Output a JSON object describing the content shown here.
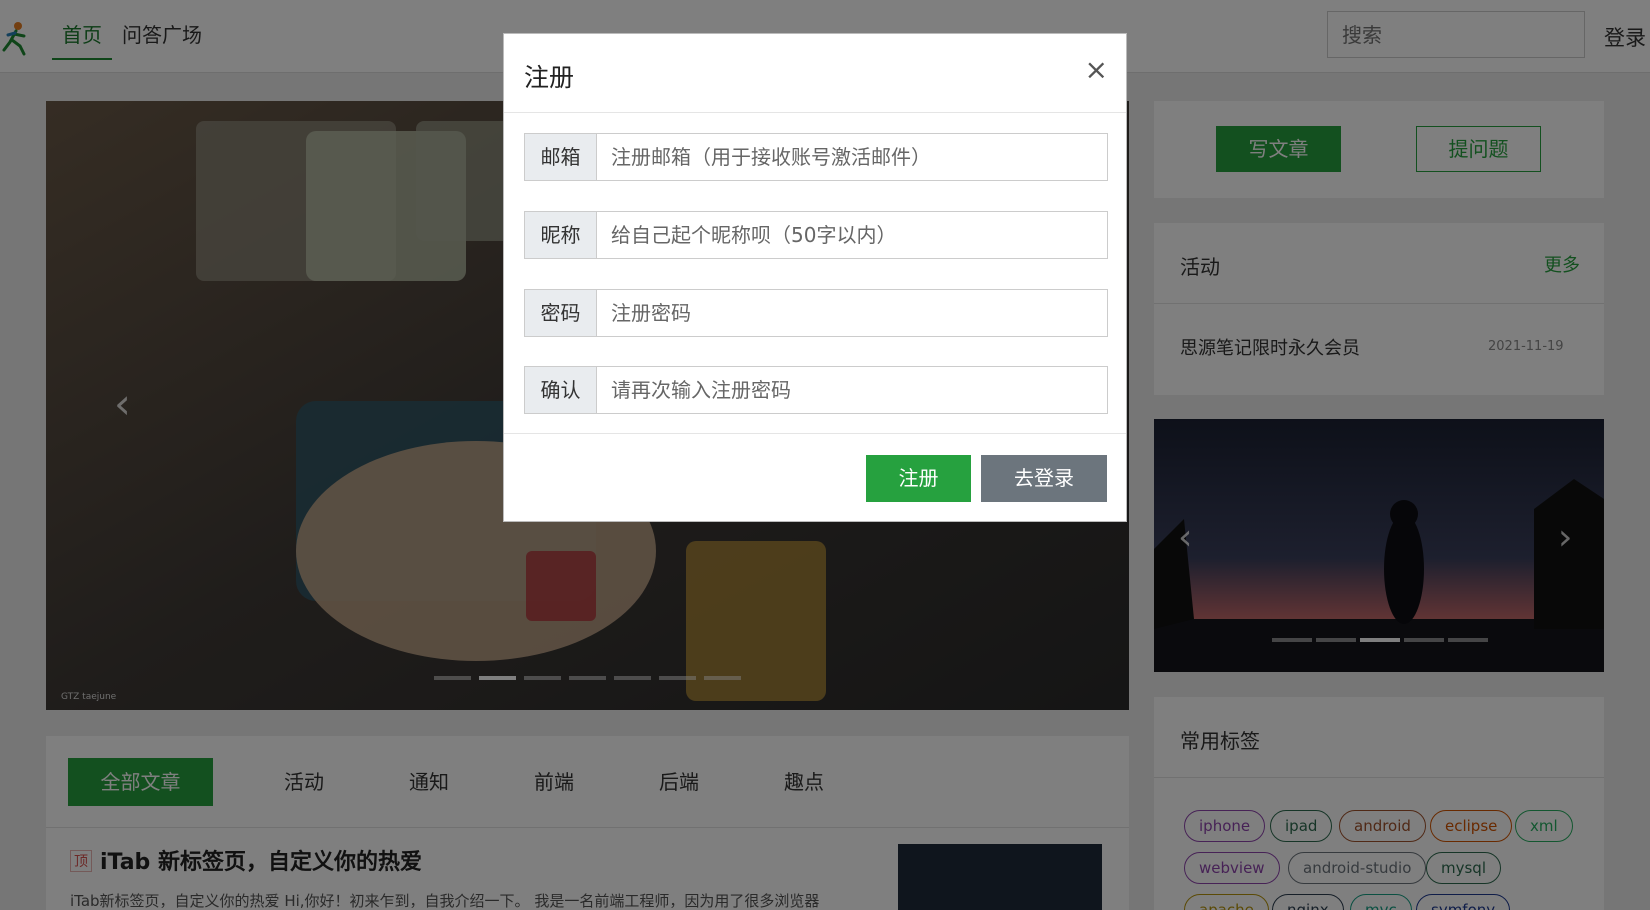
{
  "header": {
    "nav_home": "首页",
    "nav_qa": "问答广场",
    "search_placeholder": "搜索",
    "login": "登录"
  },
  "main": {
    "carousel_caption": "GTZ taejune",
    "carousel_slides": 7,
    "carousel_active_slide": 2,
    "tabs": [
      {
        "label": "全部文章",
        "active": true
      },
      {
        "label": "活动"
      },
      {
        "label": "通知"
      },
      {
        "label": "前端"
      },
      {
        "label": "后端"
      },
      {
        "label": "趣点"
      }
    ],
    "article": {
      "pin": "顶",
      "title": "iTab 新标签页，自定义你的热爱",
      "excerpt": "iTab新标签页，自定义你的热爱 Hi,你好！初来乍到，自我介绍一下。 我是一名前端工程师，因为用了很多浏览器"
    }
  },
  "sidebar": {
    "write_button": "写文章",
    "ask_button": "提问题",
    "activity_title": "活动",
    "activity_more": "更多",
    "activity_items": [
      {
        "title": "思源笔记限时永久会员",
        "date": "2021-11-19"
      }
    ],
    "tags_title": "常用标签",
    "tags": [
      {
        "label": "iphone",
        "color": "#8e44ad"
      },
      {
        "label": "ipad",
        "color": "#2d6a4f"
      },
      {
        "label": "android",
        "color": "#a0522d"
      },
      {
        "label": "eclipse",
        "color": "#d35400"
      },
      {
        "label": "xml",
        "color": "#27ae60"
      },
      {
        "label": "webview",
        "color": "#8e44ad"
      },
      {
        "label": "android-studio",
        "color": "#6c757d"
      },
      {
        "label": "mysql",
        "color": "#2d6a4f"
      },
      {
        "label": "apache",
        "color": "#b7950b"
      },
      {
        "label": "nginx",
        "color": "#2c3e50"
      },
      {
        "label": "mvc",
        "color": "#16a085"
      },
      {
        "label": "symfony",
        "color": "#1f3a93"
      }
    ]
  },
  "modal": {
    "title": "注册",
    "close": "×",
    "fields": [
      {
        "label": "邮箱",
        "placeholder": "注册邮箱（用于接收账号激活邮件）"
      },
      {
        "label": "昵称",
        "placeholder": "给自己起个昵称呗（50字以内）"
      },
      {
        "label": "密码",
        "placeholder": "注册密码"
      },
      {
        "label": "确认",
        "placeholder": "请再次输入注册密码"
      }
    ],
    "register_button": "注册",
    "login_button": "去登录"
  },
  "colors": {
    "accent": "#26a13f",
    "secondary": "#6c757d",
    "overlay": "rgba(0,0,0,0.5)"
  }
}
